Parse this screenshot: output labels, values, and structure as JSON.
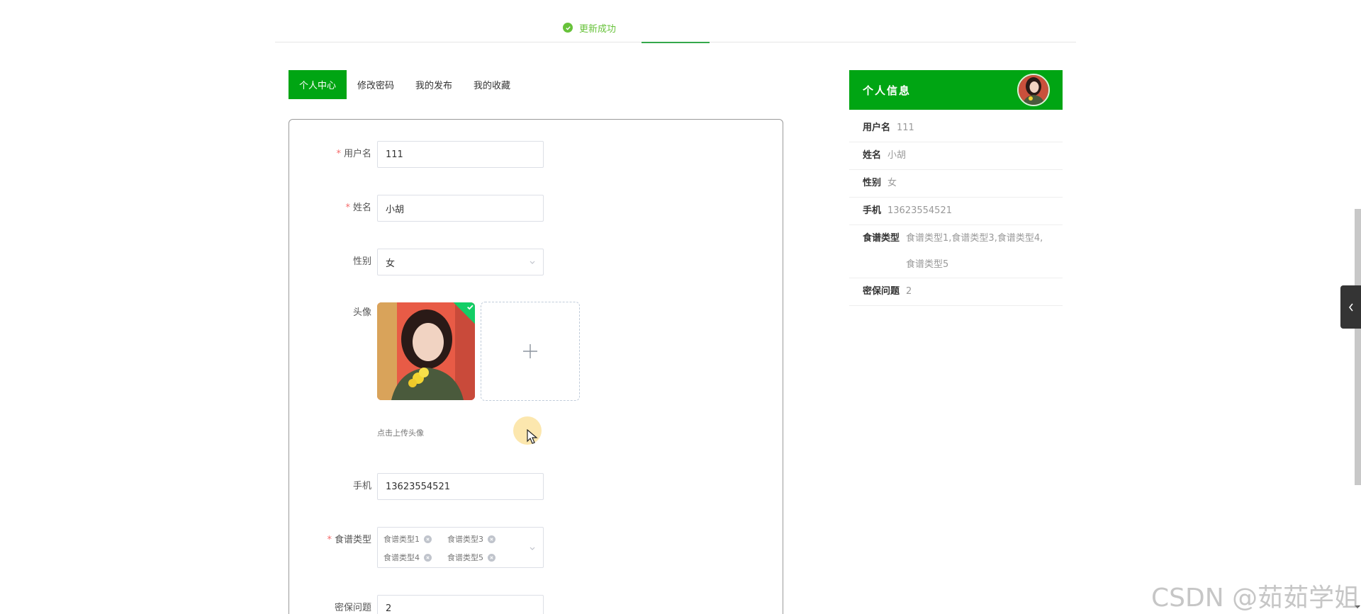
{
  "toast": {
    "icon": "success-icon",
    "message": "更新成功",
    "color": "#67c23a"
  },
  "tabs": [
    {
      "label": "个人中心",
      "active": true
    },
    {
      "label": "修改密码",
      "active": false
    },
    {
      "label": "我的发布",
      "active": false
    },
    {
      "label": "我的收藏",
      "active": false
    }
  ],
  "form": {
    "username": {
      "label": "用户名",
      "required": true,
      "value": "111"
    },
    "name": {
      "label": "姓名",
      "required": true,
      "value": "小胡"
    },
    "gender": {
      "label": "性别",
      "required": false,
      "value": "女"
    },
    "avatar": {
      "label": "头像",
      "hint": "点击上传头像"
    },
    "phone": {
      "label": "手机",
      "required": false,
      "value": "13623554521"
    },
    "recipe_types": {
      "label": "食谱类型",
      "required": true,
      "tags": [
        "食谱类型1",
        "食谱类型3",
        "食谱类型4",
        "食谱类型5"
      ]
    },
    "security_question": {
      "label": "密保问题",
      "required": false,
      "value": "2"
    }
  },
  "info": {
    "title": "个人信息",
    "rows": [
      {
        "key": "用户名",
        "value": "111"
      },
      {
        "key": "姓名",
        "value": "小胡"
      },
      {
        "key": "性别",
        "value": "女"
      },
      {
        "key": "手机",
        "value": "13623554521"
      },
      {
        "key": "食谱类型",
        "value": "食谱类型1,食谱类型3,食谱类型4,",
        "value2": "食谱类型5"
      },
      {
        "key": "密保问题",
        "value": "2"
      }
    ]
  },
  "watermark": "CSDN @茹茹学姐",
  "colors": {
    "brand": "#00a513",
    "success": "#67c23a",
    "required": "#f56c6c"
  }
}
